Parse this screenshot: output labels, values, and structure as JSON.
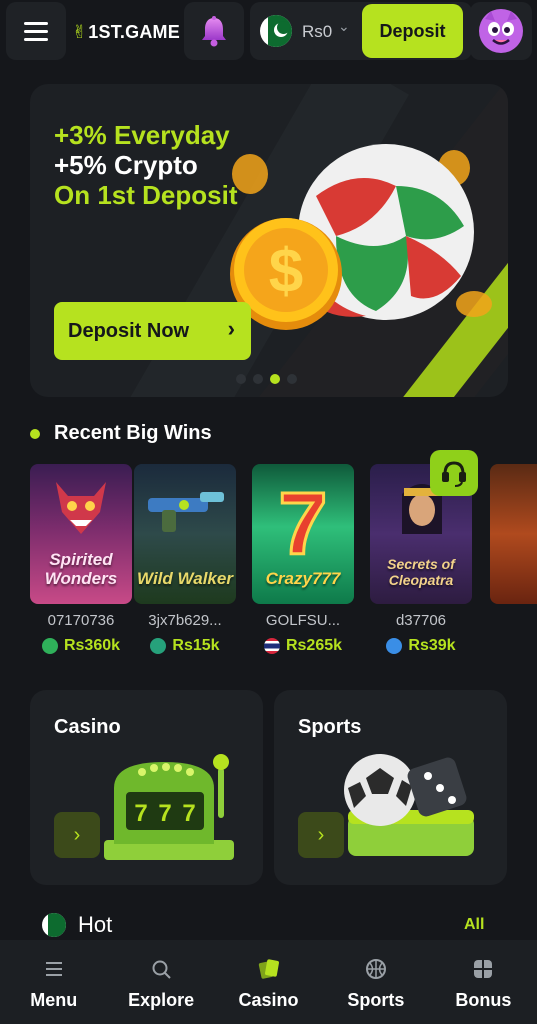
{
  "header": {
    "logo_text": "1ST.GAME",
    "balance": "Rs0",
    "deposit_label": "Deposit"
  },
  "banner": {
    "line1": "+3% Everyday",
    "line2": "+5% Crypto",
    "line3": "On 1st Deposit",
    "cta_label": "Deposit Now",
    "slide_count": 4,
    "active_slide": 3
  },
  "recent_wins": {
    "title": "Recent Big Wins",
    "items": [
      {
        "game": "Spirited Wonders",
        "user": "07170736",
        "amount": "Rs360k",
        "currency_icon": "green-coin-icon"
      },
      {
        "game": "Wild Walker",
        "user": "3jx7b629...",
        "amount": "Rs15k",
        "currency_icon": "tether-icon"
      },
      {
        "game": "Crazy777",
        "user": "GOLFSU...",
        "amount": "Rs265k",
        "currency_icon": "thai-flag-icon"
      },
      {
        "game": "Secrets of Cleopatra",
        "user": "d37706",
        "amount": "Rs39k",
        "currency_icon": "diamond-icon"
      },
      {
        "game": "",
        "user": "",
        "amount": "",
        "currency_icon": ""
      }
    ]
  },
  "categories": [
    {
      "title": "Casino"
    },
    {
      "title": "Sports"
    }
  ],
  "hot": {
    "title": "Hot",
    "all_label": "All"
  },
  "bottom_nav": [
    {
      "label": "Menu",
      "icon": "menu-icon"
    },
    {
      "label": "Explore",
      "icon": "explore-icon"
    },
    {
      "label": "Casino",
      "icon": "casino-cards-icon",
      "active": true
    },
    {
      "label": "Sports",
      "icon": "basketball-icon"
    },
    {
      "label": "Bonus",
      "icon": "gift-icon"
    }
  ],
  "colors": {
    "accent": "#b6e21f",
    "background": "#15171b",
    "card": "#1e2125"
  }
}
